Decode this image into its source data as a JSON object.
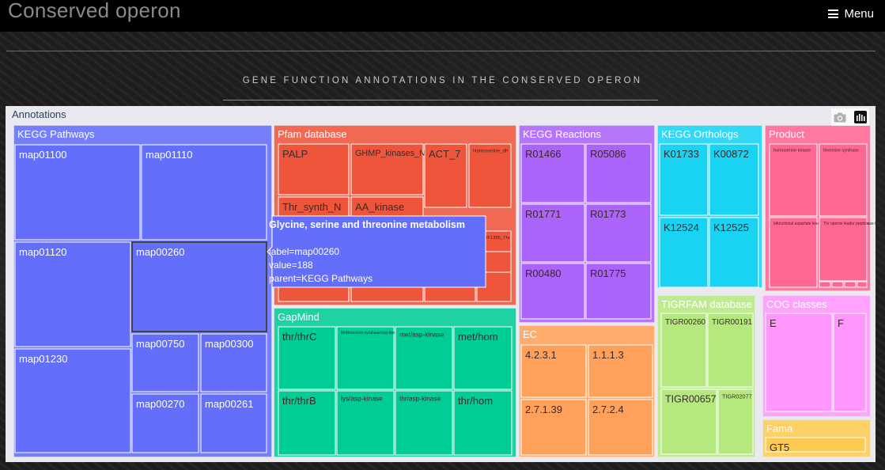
{
  "header": {
    "site_title": "Conserved operon",
    "menu_label": "Menu"
  },
  "section": {
    "subtitle": "GENE FUNCTION ANNOTATIONS IN THE CONSERVED OPERON"
  },
  "treemap": {
    "root_label": "Annotations",
    "icons": [
      "camera-icon",
      "plotly-logo-icon"
    ],
    "groups": [
      {
        "label": "KEGG Pathways",
        "color": "#636efa",
        "leaves": [
          "map01100",
          "map01110",
          "map01120",
          "map00260",
          "map01230",
          "map00750",
          "map00300",
          "map00270",
          "map00261"
        ]
      },
      {
        "label": "Pfam database",
        "color": "#ef553b",
        "leaves": [
          "PALP",
          "GHMP_kinases_N",
          "ACT_7",
          "Homoserine_dh",
          "Thr_synth_N",
          "AA_kinase",
          "",
          "",
          "",
          "",
          "NAD_binding_3",
          "",
          "",
          "",
          "DUF1385_Thr"
        ]
      },
      {
        "label": "KEGG Reactions",
        "color": "#ab63fa",
        "leaves": [
          "R01466",
          "R05086",
          "R01771",
          "R01773",
          "R00480",
          "R01775"
        ]
      },
      {
        "label": "KEGG Orthologs",
        "color": "#19d3f3",
        "leaves": [
          "K01733",
          "K00872",
          "K12524",
          "K12525"
        ]
      },
      {
        "label": "Product",
        "color": "#ff6692",
        "leaves": [
          "homoserine kinase",
          "threonine synthase",
          "bifunctional aspartate kinase/homoserine dehydrogenase I",
          "Thr operon leader peptide",
          "",
          "",
          "",
          ""
        ]
      },
      {
        "label": "GapMind",
        "color": "#00cc96",
        "leaves": [
          "thr/thrC",
          "thr/threonine-synthase/asp-kinase",
          "met/asp-kinase",
          "met/hom",
          "thr/thrB",
          "lys/asp-kinase",
          "thr/asp-kinase",
          "thr/hom"
        ]
      },
      {
        "label": "EC",
        "color": "#ffa15a",
        "leaves": [
          "4.2.3.1",
          "1.1.1.3",
          "2.7.1.39",
          "2.7.2.4"
        ]
      },
      {
        "label": "TIGRFAM database",
        "color": "#b6e880",
        "leaves": [
          "TIGR00260",
          "TIGR00191",
          "TIGR00657",
          "TIGR02077"
        ]
      },
      {
        "label": "COG classes",
        "color": "#ff97ff",
        "leaves": [
          "E",
          "F"
        ]
      },
      {
        "label": "Fama",
        "color": "#fecb52",
        "leaves": [
          "GT5"
        ]
      }
    ],
    "hover": {
      "title": "Glycine, serine and threonine metabolism",
      "label_line": "label=map00260",
      "value_line": "value=188",
      "parent_line": "parent=KEGG Pathways",
      "color": "#636efa"
    }
  }
}
